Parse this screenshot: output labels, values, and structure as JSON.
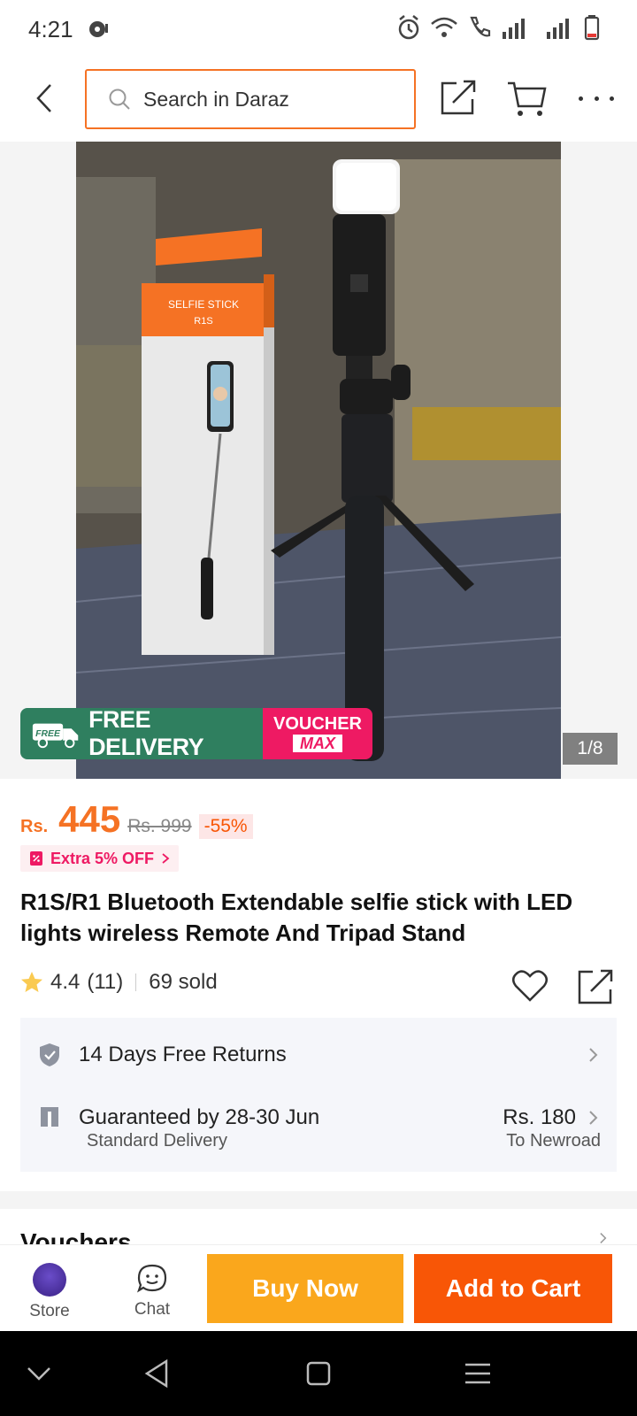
{
  "status_bar": {
    "time": "4:21"
  },
  "header": {
    "search_placeholder": "Search in Daraz"
  },
  "gallery": {
    "page_indicator": "1/8",
    "free_delivery_text": "FREE DELIVERY",
    "free_badge": "FREE",
    "voucher_line1": "VOUCHER",
    "voucher_line2": "MAX",
    "box_print_line1": "SELFIE STICK",
    "box_print_line2": "R1S"
  },
  "price": {
    "currency": "Rs.",
    "current": "445",
    "original": "Rs. 999",
    "discount": "-55%",
    "extra_off": "Extra 5% OFF"
  },
  "product": {
    "title": "R1S/R1 Bluetooth Extendable selfie stick with LED lights wireless Remote And Tripad Stand",
    "rating": "4.4",
    "rating_count": "(11)",
    "sold": "69 sold"
  },
  "services": {
    "returns": "14 Days Free Returns",
    "guarantee": "Guaranteed by 28-30 Jun",
    "delivery_type": "Standard Delivery",
    "delivery_price": "Rs. 180",
    "delivery_to": "To Newroad"
  },
  "vouchers_label": "Vouchers",
  "action_bar": {
    "store_label": "Store",
    "chat_label": "Chat",
    "buy_now": "Buy Now",
    "add_to_cart": "Add to Cart"
  },
  "colors": {
    "accent_orange": "#f57224",
    "buy_now": "#faa71c",
    "add_to_cart": "#f85606",
    "voucher_pink": "#ee1a63",
    "free_delivery_green": "#2f7f5f"
  }
}
